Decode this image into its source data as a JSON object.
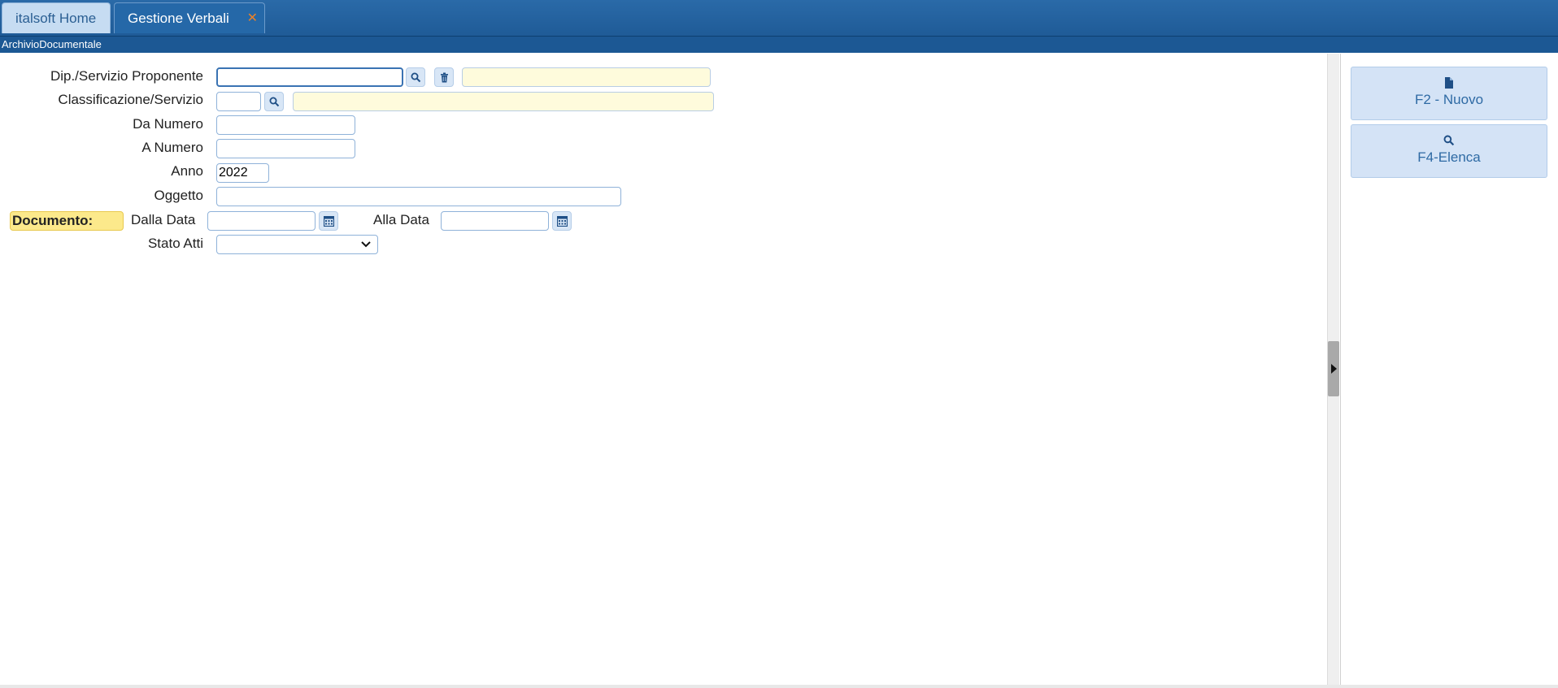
{
  "tabs": {
    "home_label": "italsoft Home",
    "active_label": "Gestione Verbali",
    "close_glyph": "✕"
  },
  "breadcrumb": "ArchivioDocumentale",
  "form": {
    "dip_label": "Dip./Servizio Proponente",
    "dip_value": "",
    "dip_desc": "",
    "classificazione_label": "Classificazione/Servizio",
    "classificazione_value": "",
    "classificazione_desc": "",
    "da_numero_label": "Da Numero",
    "da_numero_value": "",
    "a_numero_label": "A Numero",
    "a_numero_value": "",
    "anno_label": "Anno",
    "anno_value": "2022",
    "oggetto_label": "Oggetto",
    "oggetto_value": "",
    "documento_label": "Documento:",
    "dalla_data_label": "Dalla Data",
    "dalla_data_value": "",
    "alla_data_label": "Alla Data",
    "alla_data_value": "",
    "stato_atti_label": "Stato Atti",
    "stato_atti_value": ""
  },
  "actions": {
    "nuovo_label": "F2 - Nuovo",
    "nuovo_icon": "file-icon",
    "elenca_label": "F4-Elenca",
    "elenca_icon": "search-icon"
  },
  "colors": {
    "tabbar": "#1f5b97",
    "accent": "#2e6aa4",
    "field_desc": "#fefbdc",
    "highlight": "#fce98b"
  }
}
